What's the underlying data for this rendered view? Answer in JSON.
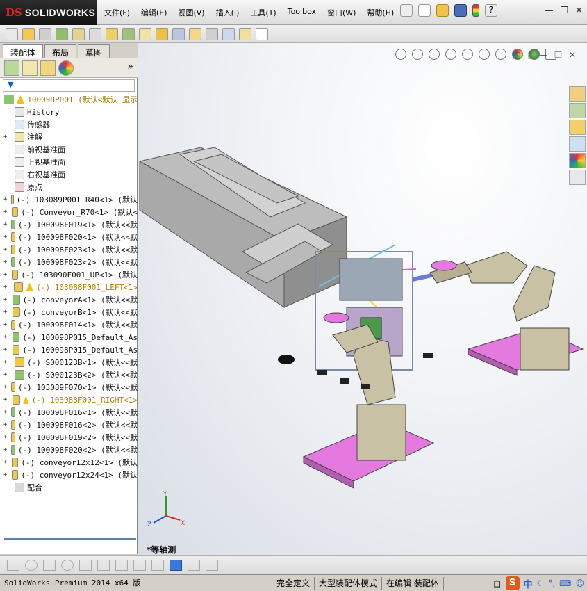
{
  "app": {
    "brand_ds": "DS",
    "brand": "SOLIDWORKS"
  },
  "menu": {
    "items": [
      "文件(F)",
      "编辑(E)",
      "视图(V)",
      "插入(I)",
      "工具(T)",
      "Toolbox",
      "窗口(W)",
      "帮助(H)"
    ]
  },
  "window_controls": {
    "minimize": "—",
    "restore": "❐",
    "close": "✕"
  },
  "panel": {
    "tabs": [
      "装配体",
      "布局",
      "草图"
    ],
    "more": "»"
  },
  "tree": {
    "root": "100098P001  (默认<默认_显示",
    "items": [
      {
        "label": "History",
        "warn": false,
        "expandable": false
      },
      {
        "label": "传感器",
        "warn": false,
        "expandable": false
      },
      {
        "label": "注解",
        "warn": false,
        "expandable": true
      },
      {
        "label": "前视基准面",
        "warn": false,
        "expandable": false
      },
      {
        "label": "上视基准面",
        "warn": false,
        "expandable": false
      },
      {
        "label": "右视基准面",
        "warn": false,
        "expandable": false
      },
      {
        "label": "原点",
        "warn": false,
        "expandable": false
      },
      {
        "label": "(-) 103089P001_R40<1> (默认",
        "warn": false,
        "expandable": true
      },
      {
        "label": "(-) Conveyor_R70<1> (默认<",
        "warn": false,
        "expandable": true
      },
      {
        "label": "(-) 100098F019<1> (默认<<默",
        "warn": false,
        "expandable": true
      },
      {
        "label": "(-) 100098F020<1> (默认<<默",
        "warn": false,
        "expandable": true
      },
      {
        "label": "(-) 100098F023<1> (默认<<默",
        "warn": false,
        "expandable": true
      },
      {
        "label": "(-) 100098F023<2> (默认<<默",
        "warn": false,
        "expandable": true
      },
      {
        "label": "(-) 103090F001_UP<1> (默认",
        "warn": false,
        "expandable": true
      },
      {
        "label": "(-) 103088F001_LEFT<1>",
        "warn": true,
        "expandable": true
      },
      {
        "label": "(-) conveyorA<1> (默认<<默",
        "warn": false,
        "expandable": true
      },
      {
        "label": "(-) conveyorB<1> (默认<<默",
        "warn": false,
        "expandable": true
      },
      {
        "label": "(-) 100098F014<1> (默认<<默",
        "warn": false,
        "expandable": true
      },
      {
        "label": "(-) 100098P015_Default_As",
        "warn": false,
        "expandable": true
      },
      {
        "label": "(-) 100098P015_Default_As",
        "warn": false,
        "expandable": true
      },
      {
        "label": "(-) S000123B<1> (默认<<默",
        "warn": false,
        "expandable": true
      },
      {
        "label": "(-) S000123B<2> (默认<<默",
        "warn": false,
        "expandable": true
      },
      {
        "label": "(-) 103089F070<1> (默认<<默",
        "warn": false,
        "expandable": true
      },
      {
        "label": "(-) 103088F001_RIGHT<1>",
        "warn": true,
        "expandable": true
      },
      {
        "label": "(-) 100098F016<1> (默认<<默",
        "warn": false,
        "expandable": true
      },
      {
        "label": "(-) 100098F016<2> (默认<<默",
        "warn": false,
        "expandable": true
      },
      {
        "label": "(-) 100098F019<2> (默认<<默",
        "warn": false,
        "expandable": true
      },
      {
        "label": "(-) 100098F020<2> (默认<<默",
        "warn": false,
        "expandable": true
      },
      {
        "label": "(-) conveyor12x12<1> (默认",
        "warn": false,
        "expandable": true
      },
      {
        "label": "(-) conveyor12x24<1> (默认",
        "warn": false,
        "expandable": true
      },
      {
        "label": "配合",
        "warn": false,
        "expandable": false
      }
    ]
  },
  "view": {
    "label": "*等轴测",
    "triad": {
      "x": "X",
      "y": "Y",
      "z": "Z"
    }
  },
  "status": {
    "product": "SolidWorks Premium 2014 x64 版",
    "segments": [
      "完全定义",
      "大型装配体模式",
      "在编辑 装配体"
    ],
    "trailing": "自",
    "ime_logo": "S",
    "ime_lang": "中"
  },
  "colors": {
    "robot_body": "#c8c1a3",
    "platform": "#e47ae0",
    "accent": "#3c78d8"
  }
}
